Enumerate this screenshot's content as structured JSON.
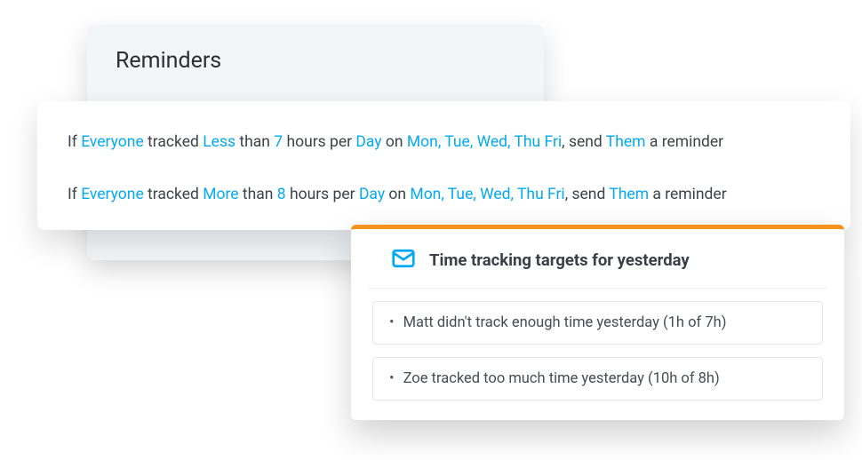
{
  "reminders": {
    "title": "Reminders",
    "rules": [
      {
        "prefix": "If ",
        "who": "Everyone",
        "t1": " tracked ",
        "comparison": "Less",
        "t2": " than ",
        "hours": "7",
        "t3": " hours per ",
        "unit": "Day",
        "t4": " on ",
        "days": "Mon, Tue, Wed, Thu Fri",
        "t5": ", send ",
        "recipient": "Them",
        "suffix": " a reminder"
      },
      {
        "prefix": "If ",
        "who": "Everyone",
        "t1": " tracked ",
        "comparison": "More",
        "t2": " than ",
        "hours": "8",
        "t3": " hours per ",
        "unit": "Day",
        "t4": " on ",
        "days": "Mon, Tue, Wed, Thu Fri",
        "t5": ", send ",
        "recipient": "Them",
        "suffix": " a reminder"
      }
    ]
  },
  "targets": {
    "title": "Time tracking targets for yesterday",
    "items": [
      "Matt didn't track enough time yesterday (1h of 7h)",
      "Zoe tracked too much time yesterday (10h of 8h)"
    ]
  }
}
